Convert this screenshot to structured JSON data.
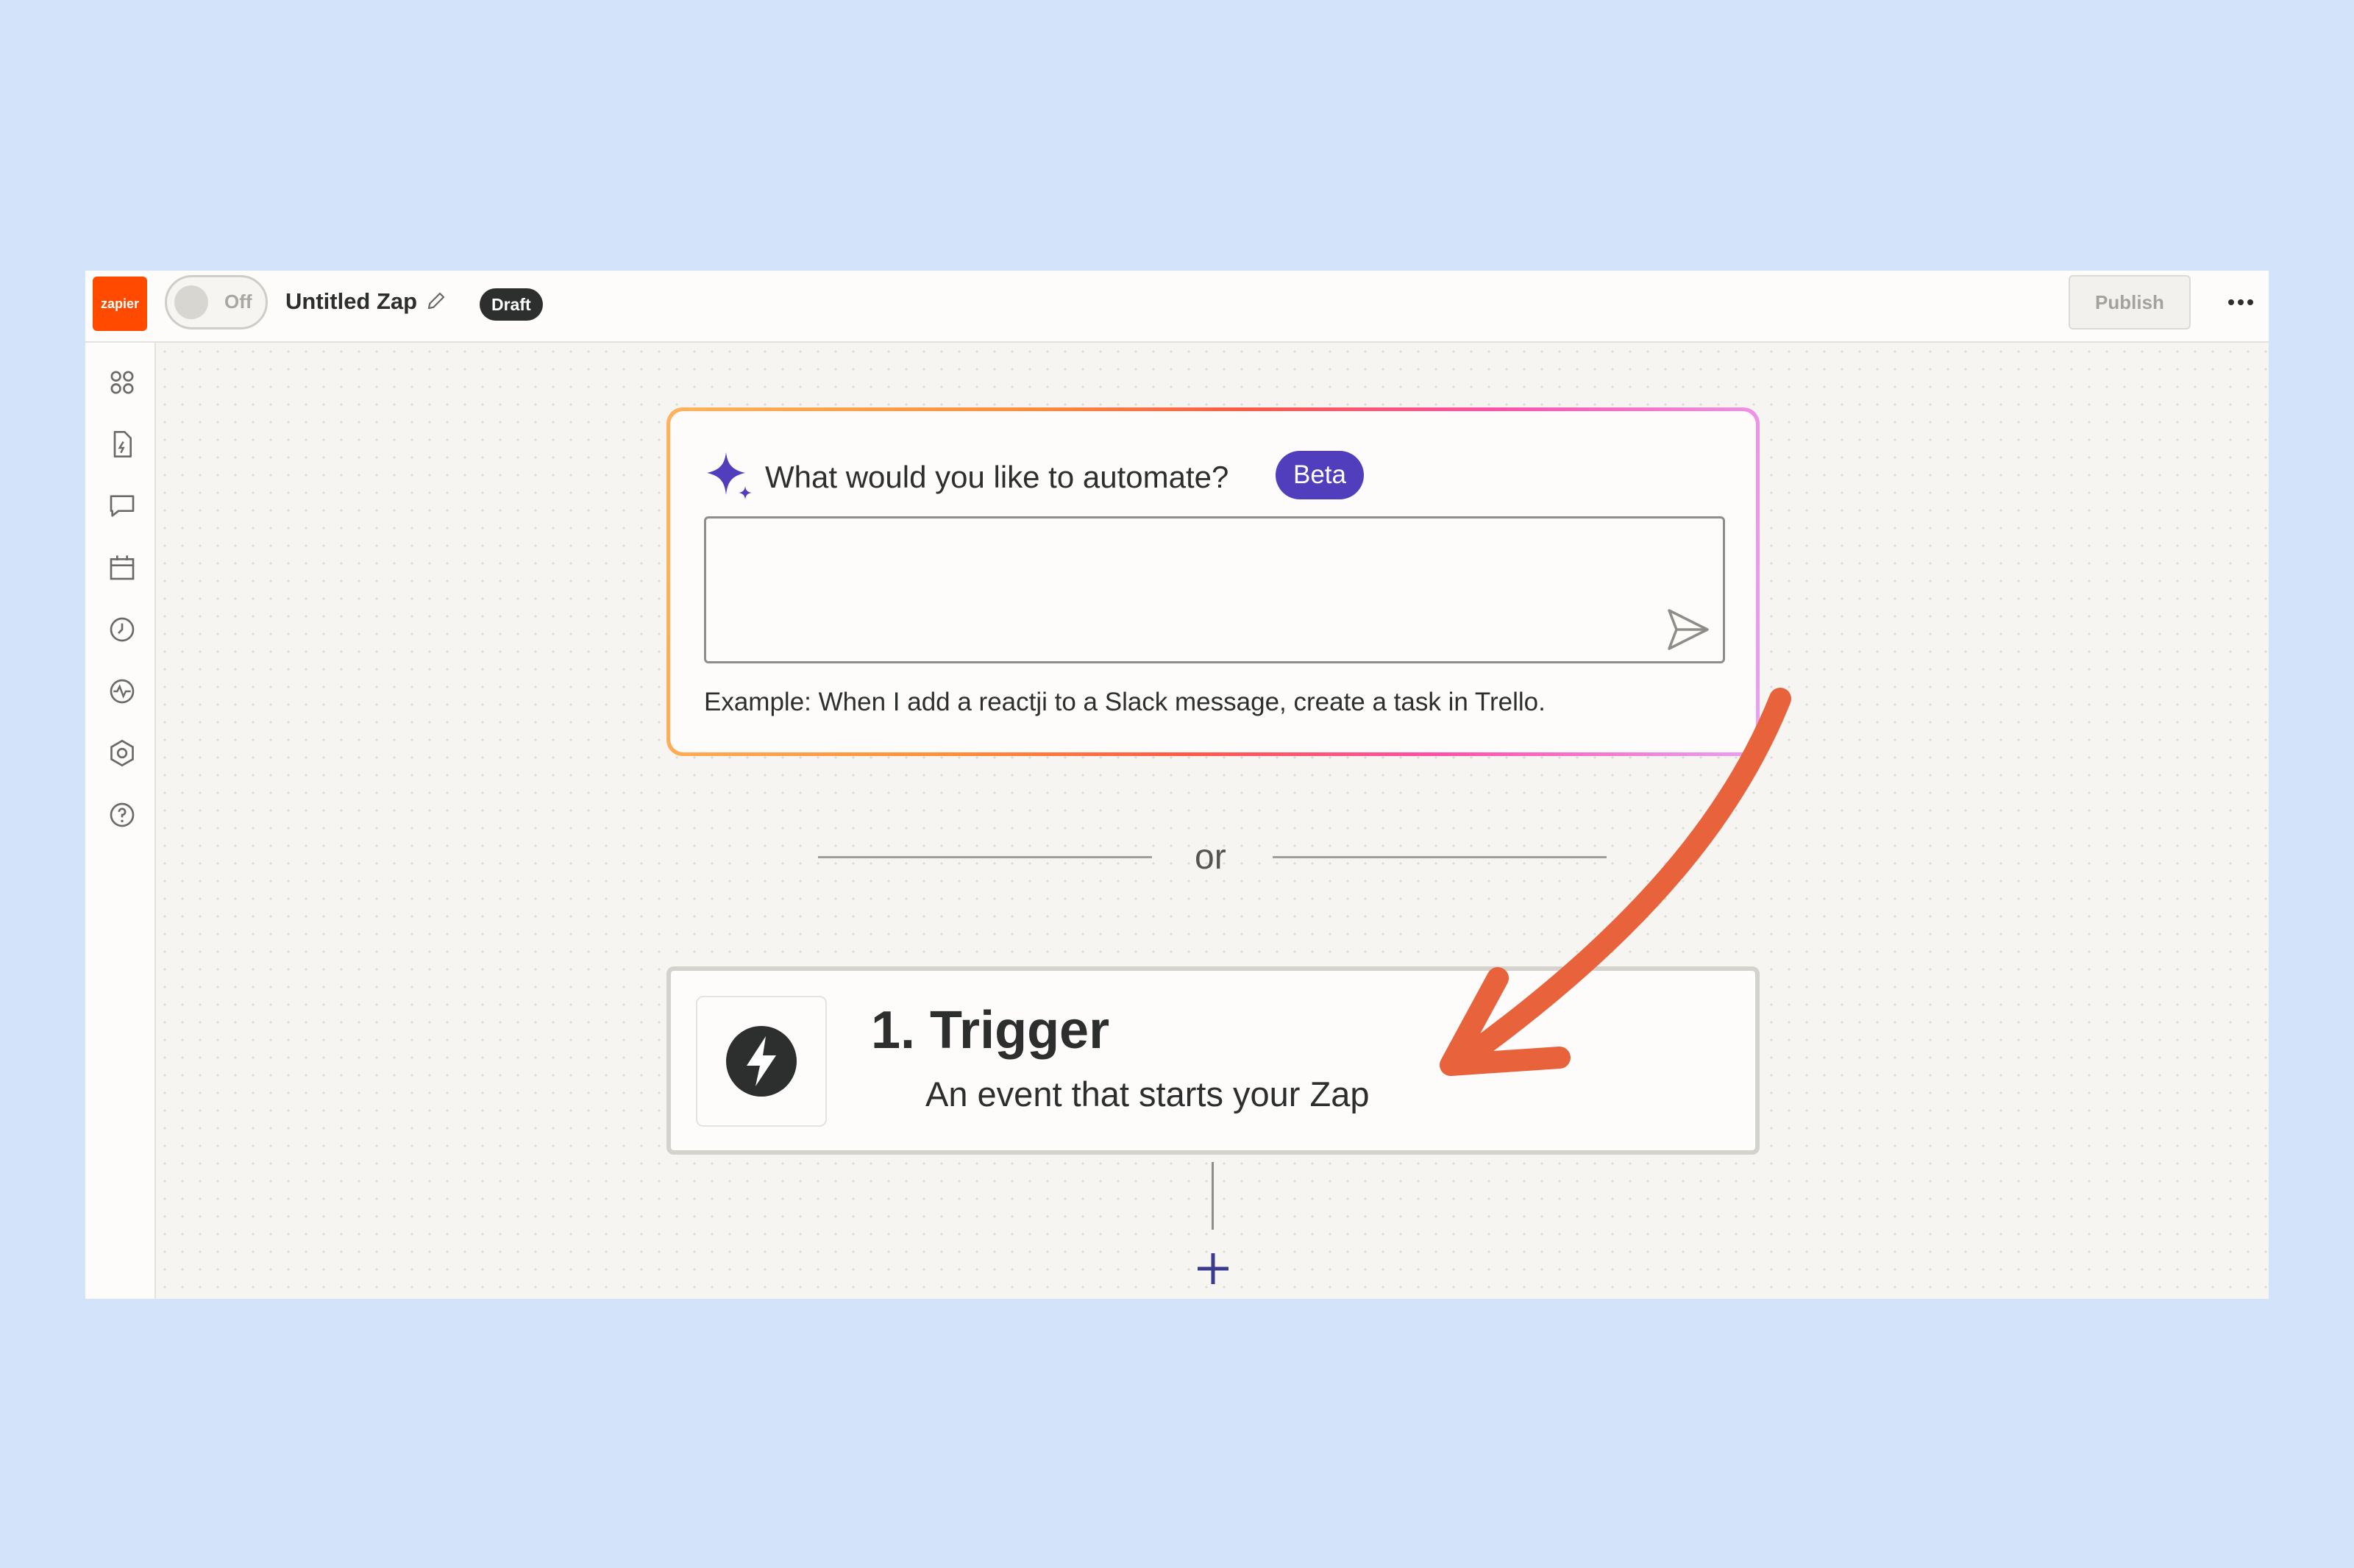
{
  "header": {
    "logo_text": "zapier",
    "toggle_label": "Off",
    "zap_title": "Untitled Zap",
    "status_badge": "Draft",
    "publish_label": "Publish"
  },
  "sidebar": {
    "icons": [
      "apps-icon",
      "zap-file-icon",
      "chat-icon",
      "calendar-icon",
      "history-icon",
      "activity-icon",
      "settings-icon",
      "help-icon"
    ]
  },
  "ai_prompt": {
    "question": "What would you like to automate?",
    "badge": "Beta",
    "input_value": "",
    "example": "Example: When I add a reactji to a Slack message, create a task in Trello."
  },
  "divider": {
    "text": "or"
  },
  "trigger": {
    "title": "1. Trigger",
    "description": "An event that starts your Zap"
  },
  "colors": {
    "brand": "#ff4a00",
    "beta_badge": "#503ebd",
    "annotation_arrow": "#e8623b",
    "page_background": "#d3e3fa"
  }
}
